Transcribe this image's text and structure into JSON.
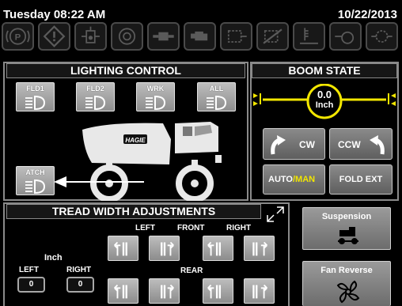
{
  "header": {
    "time": "Tuesday 08:22 AM",
    "date": "10/22/2013"
  },
  "warning_icons": [
    "parking-brake-icon",
    "warning-diamond-icon",
    "hydraulic-pressure-icon",
    "engine-fan-icon",
    "transmission-icon",
    "engine-icon",
    "dpf-filter-icon",
    "regen-inhibit-icon",
    "exhaust-temp-icon",
    "engine-coolant-icon",
    "oil-pressure-icon"
  ],
  "lighting": {
    "title": "LIGHTING CONTROL",
    "buttons": [
      {
        "label": "FLD1"
      },
      {
        "label": "FLD2"
      },
      {
        "label": "WRK"
      },
      {
        "label": "ALL"
      },
      {
        "label": "ATCH"
      }
    ]
  },
  "boom": {
    "title": "BOOM STATE",
    "value": "0.0",
    "unit": "Inch",
    "cw_label": "CW",
    "ccw_label": "CCW",
    "auto_label": "AUTO",
    "slash": "/",
    "man_label": "MAN",
    "fold_label": "FOLD EXT",
    "colors": {
      "accent": "#f2e600",
      "man": "#f2e600"
    }
  },
  "tread": {
    "title": "TREAD WIDTH ADJUSTMENTS",
    "front": {
      "left": "LEFT",
      "front": "FRONT",
      "right": "RIGHT"
    },
    "rear_label": "REAR",
    "unit": "Inch",
    "left_label": "LEFT",
    "right_label": "RIGHT",
    "left_value": "0",
    "right_value": "0"
  },
  "side": {
    "suspension": "Suspension",
    "fan_reverse": "Fan Reverse"
  },
  "machine_brand": "HAGIE"
}
